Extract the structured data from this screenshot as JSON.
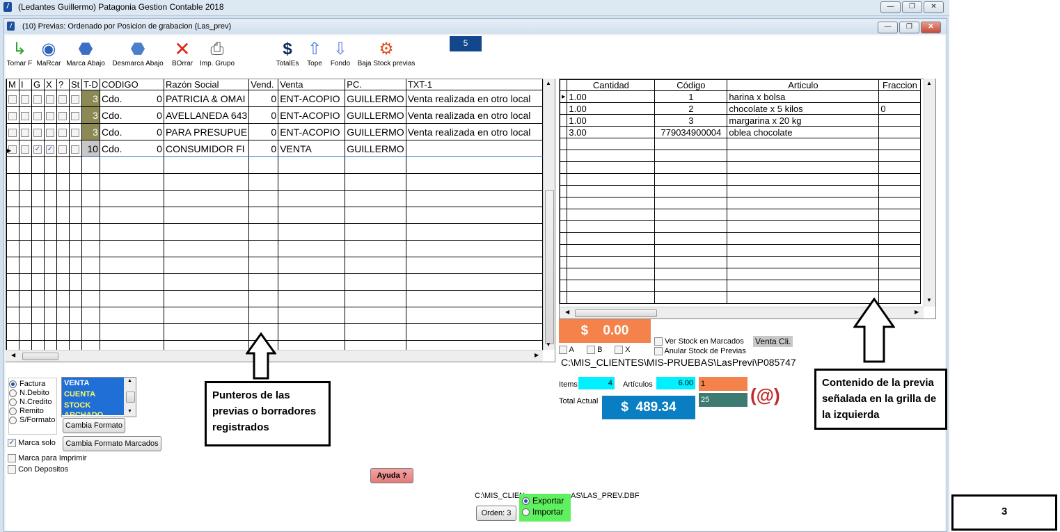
{
  "app": {
    "title": "(Ledantes Guillermo) Patagonia Gestion Contable 2018"
  },
  "window": {
    "title": "(10) Previas: Ordenado por Posicion de grabacion (Las_prev)"
  },
  "window_buttons": {
    "minimize": "—",
    "restore": "❐",
    "close": "✕"
  },
  "toolbar": {
    "items": [
      {
        "label": "Tomar F",
        "icon": "green-arrow-icon"
      },
      {
        "label": "MaRcar",
        "icon": "check-circle-icon"
      },
      {
        "label": "Marca Abajo",
        "icon": "check-down-icon"
      },
      {
        "label": "Desmarca Abajo",
        "icon": "uncheck-down-icon"
      },
      {
        "label": "BOrrar",
        "icon": "red-x-icon"
      },
      {
        "label": "Imp. Grupo",
        "icon": "printer-icon"
      },
      {
        "label": "TotalEs",
        "icon": "dollar-icon"
      },
      {
        "label": "Tope",
        "icon": "arrow-up-icon"
      },
      {
        "label": "Fondo",
        "icon": "arrow-down-icon"
      },
      {
        "label": "Baja Stock previas",
        "icon": "gear-icon"
      }
    ],
    "counter": "5"
  },
  "left_grid": {
    "headers": [
      "M",
      "I",
      "G",
      "X",
      "?",
      "St",
      "T-D",
      "CODIGO",
      "Razón Social",
      "Vend.",
      "Venta",
      "PC.",
      "TXT-1"
    ],
    "rows": [
      {
        "checks": [
          false,
          false,
          false,
          false,
          false,
          false
        ],
        "td": "3",
        "codigo_tipo": "Cdo.",
        "codigo": "0",
        "razon": "PATRICIA & OMAI",
        "vend": "0",
        "venta": "ENT-ACOPIO",
        "pc": "GUILLERMO",
        "txt": "Venta realizada en otro local"
      },
      {
        "checks": [
          false,
          false,
          false,
          false,
          false,
          false
        ],
        "td": "3",
        "codigo_tipo": "Cdo.",
        "codigo": "0",
        "razon": "AVELLANEDA 643",
        "vend": "0",
        "venta": "ENT-ACOPIO",
        "pc": "GUILLERMO",
        "txt": "Venta realizada en otro local"
      },
      {
        "checks": [
          false,
          false,
          false,
          false,
          false,
          false
        ],
        "td": "3",
        "codigo_tipo": "Cdo.",
        "codigo": "0",
        "razon": "PARA PRESUPUE",
        "vend": "0",
        "venta": "ENT-ACOPIO",
        "pc": "GUILLERMO",
        "txt": "Venta realizada en otro local"
      },
      {
        "checks": [
          false,
          false,
          true,
          true,
          false,
          false
        ],
        "td": "10",
        "codigo_tipo": "Cdo.",
        "codigo": "0",
        "razon": "CONSUMIDOR FI",
        "vend": "0",
        "venta": "VENTA",
        "pc": "GUILLERMO",
        "txt": ""
      }
    ],
    "empty_rows": 12
  },
  "right_grid": {
    "headers": [
      "Cantidad",
      "Código",
      "Articulo",
      "Fraccion"
    ],
    "rows": [
      {
        "cantidad": "1.00",
        "codigo": "1",
        "articulo": "harina x bolsa",
        "fraccion": ""
      },
      {
        "cantidad": "1.00",
        "codigo": "2",
        "articulo": "chocolate x 5 kilos",
        "fraccion": "0"
      },
      {
        "cantidad": "1.00",
        "codigo": "3",
        "articulo": "margarina x 20 kg",
        "fraccion": ""
      },
      {
        "cantidad": "3.00",
        "codigo": "779034900004",
        "articulo": "oblea chocolate",
        "fraccion": ""
      }
    ],
    "empty_rows": 14
  },
  "totals": {
    "amount": "$    0.00",
    "ver_stock": "Ver Stock en Marcados",
    "anular_stock": "Anular Stock de Previas",
    "venta_cli": "Venta Cli.",
    "check_a": "A",
    "check_b": "B",
    "check_x": "X",
    "path": "C:\\MIS_CLIENTES\\MIS-PRUEBAS\\LasPrevi\\P085747",
    "items_label": "Items",
    "items_value": "4",
    "articulos_label": "Artículos",
    "articulos_value": "6.00",
    "orange_value": "1",
    "teal_value": "25",
    "total_label": "Total Actual",
    "total_value": "$  489.34"
  },
  "doc_types": {
    "options": [
      "Factura",
      "N.Debito",
      "N.Credito",
      "Remito",
      "S/Formato"
    ],
    "selected": "Factura",
    "list": [
      "VENTA",
      "CUENTA",
      "STOCK",
      "ARCHADO"
    ],
    "cambia_formato": "Cambia Formato",
    "cambia_formato_marcados": "Cambia Formato Marcados",
    "marca_solo": "Marca solo",
    "marca_imprimir": "Marca para Imprimir",
    "con_depositos": "Con Depositos"
  },
  "bottom": {
    "ayuda": "Ayuda ?",
    "path_left": "C:\\MIS_CLIEN",
    "path_right": "AS\\LAS_PREV.DBF",
    "exportar": "Exportar",
    "importar": "Importar",
    "orden": "Orden: 3"
  },
  "annotations": {
    "left_callout": "Punteros de las previas o borradores registrados",
    "right_callout": "Contenido de la previa señalada en la grilla de la izquierda",
    "page_number": "3"
  },
  "colors": {
    "accent_blue": "#12478c",
    "orange": "#f4824a",
    "cyan": "#00f0ff",
    "total_blue": "#0a7ec2",
    "teal": "#3c7a72",
    "td_olive": "#8b8a55",
    "list_bg": "#1f6fd6"
  }
}
